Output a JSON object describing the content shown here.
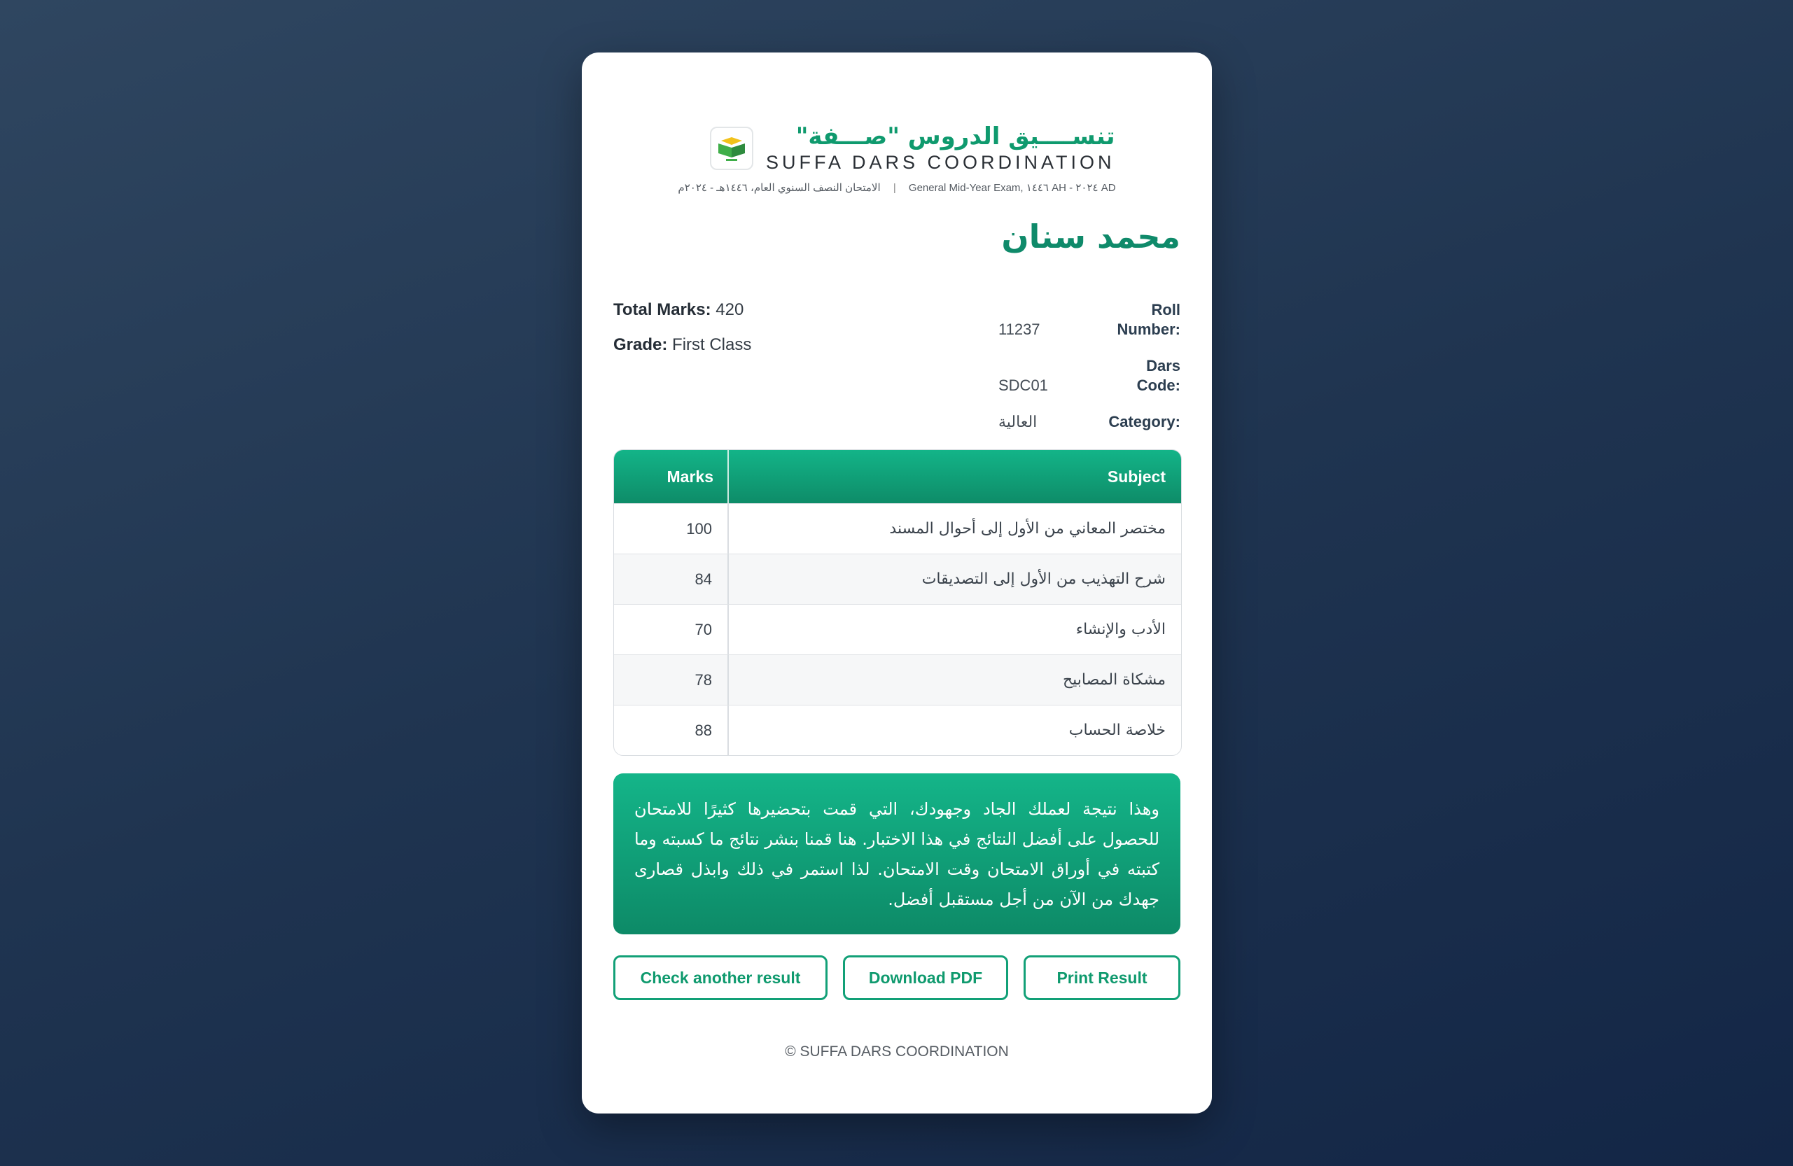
{
  "header": {
    "logo_ar": "تنســــيق الدروس \"صـــفة\"",
    "logo_en": "SUFFA DARS COORDINATION",
    "exam_en": "General Mid-Year Exam, ١٤٤٦ AH - ٢٠٢٤ AD",
    "exam_separator": "|",
    "exam_ar": "الامتحان النصف السنوي العام، ١٤٤٦هـ - ٢٠٢٤م"
  },
  "student": {
    "name": "محمد سنان",
    "total_marks_label": "Total Marks:",
    "total_marks": "420",
    "grade_label": "Grade:",
    "grade": "First Class",
    "roll_label": "Roll Number:",
    "roll_number": "11237",
    "dars_label": "Dars Code:",
    "dars_code": "SDC01",
    "category_label": "Category:",
    "category": "العالية"
  },
  "table": {
    "headers": {
      "marks": "Marks",
      "subject": "Subject"
    },
    "rows": [
      {
        "subject": "مختصر المعاني من الأول إلى أحوال المسند",
        "marks": "100"
      },
      {
        "subject": "شرح التهذيب من الأول إلى التصديقات",
        "marks": "84"
      },
      {
        "subject": "الأدب والإنشاء",
        "marks": "70"
      },
      {
        "subject": "مشكاة المصابيح",
        "marks": "78"
      },
      {
        "subject": "خلاصة الحساب",
        "marks": "88"
      }
    ]
  },
  "message": "وهذا نتيجة لعملك الجاد وجهودك، التي قمت بتحضيرها كثيرًا للامتحان للحصول على أفضل النتائج في هذا الاختبار. هنا قمنا بنشر نتائج ما كسبته وما كتبته في أوراق الامتحان وقت الامتحان. لذا استمر في ذلك وابذل قصارى جهدك من الآن من أجل مستقبل أفضل.",
  "actions": {
    "check_another": "Check another result",
    "download_pdf": "Download PDF",
    "print_result": "Print Result"
  },
  "footer": "© SUFFA DARS COORDINATION",
  "colors": {
    "accent": "#0f9a6e",
    "background": "#1f3450",
    "card": "#ffffff"
  }
}
